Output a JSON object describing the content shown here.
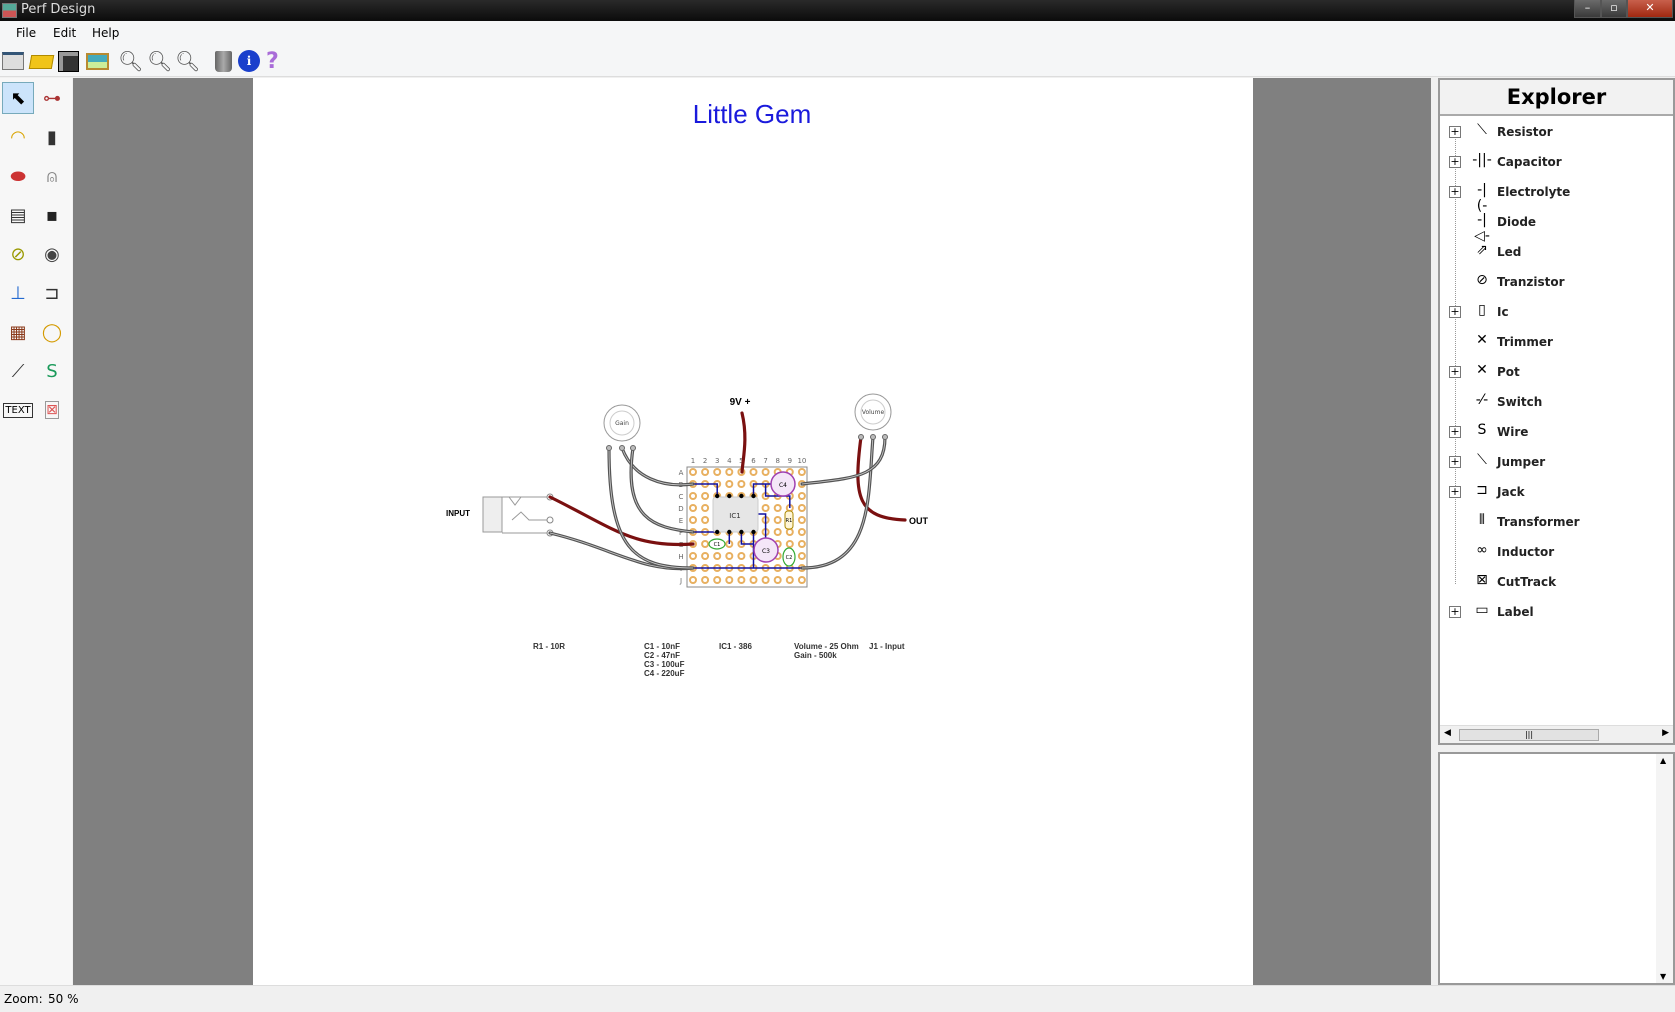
{
  "window": {
    "title": "Perf Design",
    "controls": [
      "minimize",
      "maximize",
      "close"
    ]
  },
  "menu": [
    "File",
    "Edit",
    "Help"
  ],
  "toolbar": [
    "new-icon",
    "open-icon",
    "save-icon",
    "export-image-icon",
    "zoom-in-icon",
    "zoom-reset-icon",
    "zoom-out-icon",
    "delete-icon",
    "info-icon",
    "help-icon"
  ],
  "palette": [
    "select-tool",
    "resistor",
    "ceramic-capacitor",
    "electrolytic-capacitor",
    "diode",
    "led",
    "transistor",
    "ic",
    "trimmer",
    "pot",
    "switch",
    "jack",
    "transformer",
    "inductor",
    "jumper",
    "wire",
    "text",
    "cut-track"
  ],
  "palette_text": "TEXT",
  "document": {
    "title": "Little Gem",
    "labels": {
      "power": "9V +",
      "input": "INPUT",
      "output": "OUT",
      "gain": "Gain",
      "volume": "Volume",
      "ic": "IC1",
      "c1": "C1",
      "c2": "C2",
      "c3": "C3",
      "c4": "C4",
      "r1": "R1"
    },
    "columns": [
      "1",
      "2",
      "3",
      "4",
      "5",
      "6",
      "7",
      "8",
      "9",
      "10"
    ],
    "rows": [
      "A",
      "B",
      "C",
      "D",
      "E",
      "F",
      "G",
      "H",
      "I",
      "J"
    ],
    "bom": {
      "resistors": [
        "R1 - 10R"
      ],
      "capacitors": [
        "C1 - 10nF",
        "C2 - 47nF",
        "C3 - 100uF",
        "C4 - 220uF"
      ],
      "ics": [
        "IC1 - 386"
      ],
      "pots": [
        "Volume - 25 Ohm",
        "Gain - 500k"
      ],
      "jacks": [
        "J1 - Input"
      ]
    },
    "colors": {
      "title": "#1a1adc",
      "trace": "#1010a0",
      "red_wire": "#7a1010",
      "gray_wire": "#555555",
      "pad": "#e8b060"
    }
  },
  "explorer": {
    "title": "Explorer",
    "items": [
      {
        "label": "Resistor",
        "expandable": true,
        "icon": "⟍"
      },
      {
        "label": "Capacitor",
        "expandable": true,
        "icon": "-||-"
      },
      {
        "label": "Electrolyte",
        "expandable": true,
        "icon": "-|(-"
      },
      {
        "label": "Diode",
        "expandable": false,
        "icon": "-|◁-"
      },
      {
        "label": "Led",
        "expandable": false,
        "icon": "⇗"
      },
      {
        "label": "Tranzistor",
        "expandable": false,
        "icon": "⊘"
      },
      {
        "label": "Ic",
        "expandable": true,
        "icon": "▯"
      },
      {
        "label": "Trimmer",
        "expandable": false,
        "icon": "✕"
      },
      {
        "label": "Pot",
        "expandable": true,
        "icon": "✕"
      },
      {
        "label": "Switch",
        "expandable": false,
        "icon": "-⁄-"
      },
      {
        "label": "Wire",
        "expandable": true,
        "icon": "S"
      },
      {
        "label": "Jumper",
        "expandable": true,
        "icon": "⟍"
      },
      {
        "label": "Jack",
        "expandable": true,
        "icon": "⊐"
      },
      {
        "label": "Transformer",
        "expandable": false,
        "icon": "⦀"
      },
      {
        "label": "Inductor",
        "expandable": false,
        "icon": "∞"
      },
      {
        "label": "CutTrack",
        "expandable": false,
        "icon": "⊠"
      },
      {
        "label": "Label",
        "expandable": true,
        "icon": "▭"
      }
    ]
  },
  "status": {
    "zoom_label": "Zoom:",
    "zoom_value": "50 %"
  }
}
